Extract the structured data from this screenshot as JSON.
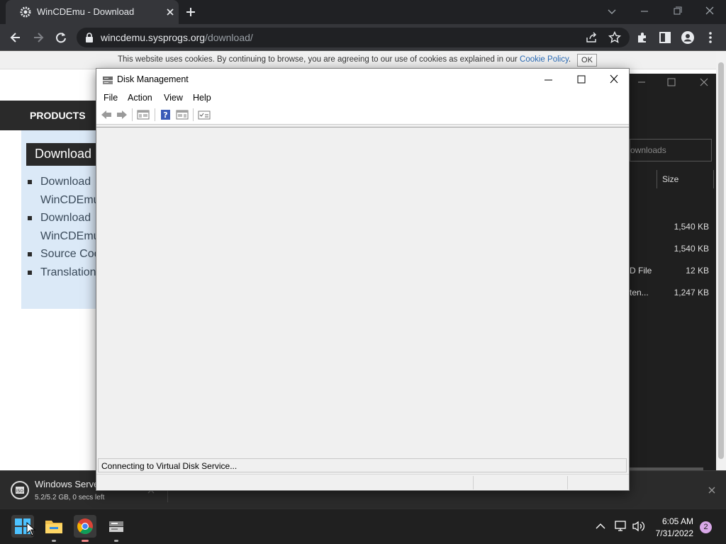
{
  "browser": {
    "tab_title": "WinCDEmu - Download",
    "url_host": "wincdemu.sysprogs.org",
    "url_path": "/download/"
  },
  "page": {
    "cookie_text": "This website uses cookies. By continuing to browse, you are agreeing to our use of cookies as explained in our",
    "cookie_link": "Cookie Policy",
    "cookie_period": ".",
    "cookie_ok": "OK",
    "nav_products": "PRODUCTS",
    "download_heading": "Download",
    "list": [
      "Download",
      "WinCDEmu",
      "Download",
      "WinCDEmu",
      "Source Coc",
      "Translation"
    ]
  },
  "explorer": {
    "search_placeholder": "ownloads",
    "size_header": "Size",
    "rows": [
      {
        "type": "",
        "size": "1,540 KB"
      },
      {
        "type": "",
        "size": "1,540 KB"
      },
      {
        "type": "D File",
        "size": "12 KB"
      },
      {
        "type": "ten...",
        "size": "1,247 KB"
      }
    ]
  },
  "download_bar": {
    "file_name": "Windows Serve",
    "status": "5.2/5.2 GB, 0 secs left"
  },
  "disk_management": {
    "title": "Disk Management",
    "menu": [
      "File",
      "Action",
      "View",
      "Help"
    ],
    "status": "Connecting to Virtual Disk Service..."
  },
  "taskbar": {
    "time": "6:05 AM",
    "date": "7/31/2022",
    "notification_count": "2"
  }
}
